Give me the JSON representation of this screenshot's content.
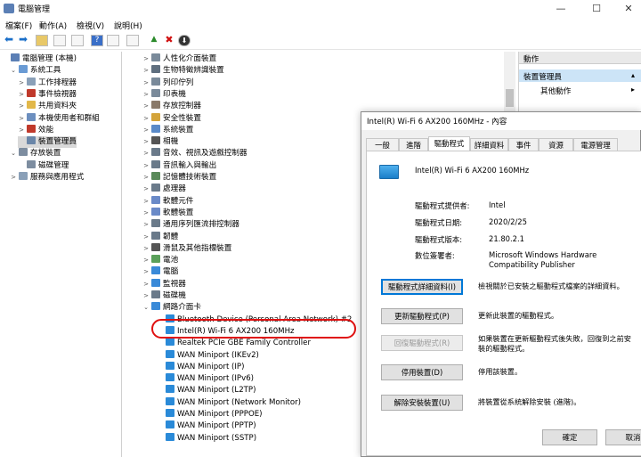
{
  "window": {
    "title": "電腦管理",
    "min": "—",
    "max": "☐",
    "close": "✕"
  },
  "menu": [
    "檔案(F)",
    "動作(A)",
    "檢視(V)",
    "說明(H)"
  ],
  "left_tree": [
    {
      "label": "電腦管理 (本機)",
      "indent": 0,
      "expander": "",
      "color": "#5b7fb5"
    },
    {
      "label": "系統工具",
      "indent": 1,
      "expander": "⌄",
      "color": "#6a9bd4"
    },
    {
      "label": "工作排程器",
      "indent": 2,
      "expander": ">",
      "color": "#8aa0b8"
    },
    {
      "label": "事件檢視器",
      "indent": 2,
      "expander": ">",
      "color": "#c0392b"
    },
    {
      "label": "共用資料夾",
      "indent": 2,
      "expander": ">",
      "color": "#e2b84a"
    },
    {
      "label": "本機使用者和群組",
      "indent": 2,
      "expander": ">",
      "color": "#6c8fbf"
    },
    {
      "label": "效能",
      "indent": 2,
      "expander": ">",
      "color": "#c0392b"
    },
    {
      "label": "裝置管理員",
      "indent": 2,
      "expander": "",
      "color": "#6a86a8",
      "selected": true
    },
    {
      "label": "存放裝置",
      "indent": 1,
      "expander": "⌄",
      "color": "#7d8da0"
    },
    {
      "label": "磁碟管理",
      "indent": 2,
      "expander": "",
      "color": "#7d8da0"
    },
    {
      "label": "服務與應用程式",
      "indent": 1,
      "expander": ">",
      "color": "#8aa0b8"
    }
  ],
  "device_tree": [
    {
      "label": "人性化介面裝置",
      "color": "#7a8a9a"
    },
    {
      "label": "生物特徵辨識裝置",
      "color": "#5f6f7f"
    },
    {
      "label": "列印佇列",
      "color": "#7a8a9a"
    },
    {
      "label": "印表機",
      "color": "#7a8a9a"
    },
    {
      "label": "存放控制器",
      "color": "#8a7a6a"
    },
    {
      "label": "安全性裝置",
      "color": "#d4a43a"
    },
    {
      "label": "系統裝置",
      "color": "#5a8ac8"
    },
    {
      "label": "相機",
      "color": "#555555"
    },
    {
      "label": "音效、視訊及遊戲控制器",
      "color": "#6a7a8a"
    },
    {
      "label": "音訊輸入與輸出",
      "color": "#6a7a8a"
    },
    {
      "label": "記憶體技術裝置",
      "color": "#5a8a5a"
    },
    {
      "label": "處理器",
      "color": "#6a7a8a"
    },
    {
      "label": "軟體元件",
      "color": "#6a8ac8"
    },
    {
      "label": "軟體裝置",
      "color": "#6a8ac8"
    },
    {
      "label": "通用序列匯流排控制器",
      "color": "#6a7a8a"
    },
    {
      "label": "韌體",
      "color": "#6a7a8a"
    },
    {
      "label": "滑鼠及其他指標裝置",
      "color": "#555555"
    },
    {
      "label": "電池",
      "color": "#5aa05a"
    },
    {
      "label": "電腦",
      "color": "#3a8ad8"
    },
    {
      "label": "監視器",
      "color": "#3a8ad8"
    },
    {
      "label": "磁碟機",
      "color": "#6a7a8a"
    },
    {
      "label": "網路介面卡",
      "color": "#3a8ad8",
      "expanded": true
    }
  ],
  "network_adapters": [
    "Bluetooth Device (Personal Area Network) #2",
    "Intel(R) Wi-Fi 6 AX200 160MHz",
    "Realtek PCIe GBE Family Controller",
    "WAN Miniport (IKEv2)",
    "WAN Miniport (IP)",
    "WAN Miniport (IPv6)",
    "WAN Miniport (L2TP)",
    "WAN Miniport (Network Monitor)",
    "WAN Miniport (PPPOE)",
    "WAN Miniport (PPTP)",
    "WAN Miniport (SSTP)"
  ],
  "actions": {
    "header": "動作",
    "section": "裝置管理員",
    "more": "其他動作",
    "more_arrow": "▸"
  },
  "dialog": {
    "title": "Intel(R) Wi-Fi 6 AX200 160MHz - 內容",
    "tabs": [
      "一般",
      "進階",
      "驅動程式",
      "詳細資料",
      "事件",
      "資源",
      "電源管理"
    ],
    "device_name": "Intel(R) Wi-Fi 6 AX200 160MHz",
    "fields": [
      {
        "label": "驅動程式提供者:",
        "value": "Intel"
      },
      {
        "label": "驅動程式日期:",
        "value": "2020/2/25"
      },
      {
        "label": "驅動程式版本:",
        "value": "21.80.2.1"
      },
      {
        "label": "數位簽署者:",
        "value": "Microsoft Windows Hardware Compatibility Publisher"
      }
    ],
    "buttons": [
      {
        "label": "驅動程式詳細資料(I)",
        "desc": "檢視關於已安裝之驅動程式檔案的詳細資料。"
      },
      {
        "label": "更新驅動程式(P)",
        "desc": "更新此裝置的驅動程式。"
      },
      {
        "label": "回復驅動程式(R)",
        "desc": "如果裝置在更新驅動程式後失敗，回復到之前安裝的驅動程式。"
      },
      {
        "label": "停用裝置(D)",
        "desc": "停用該裝置。"
      },
      {
        "label": "解除安裝裝置(U)",
        "desc": "將裝置從系統解除安裝 (進階)。"
      }
    ],
    "ok": "確定",
    "cancel": "取消"
  }
}
